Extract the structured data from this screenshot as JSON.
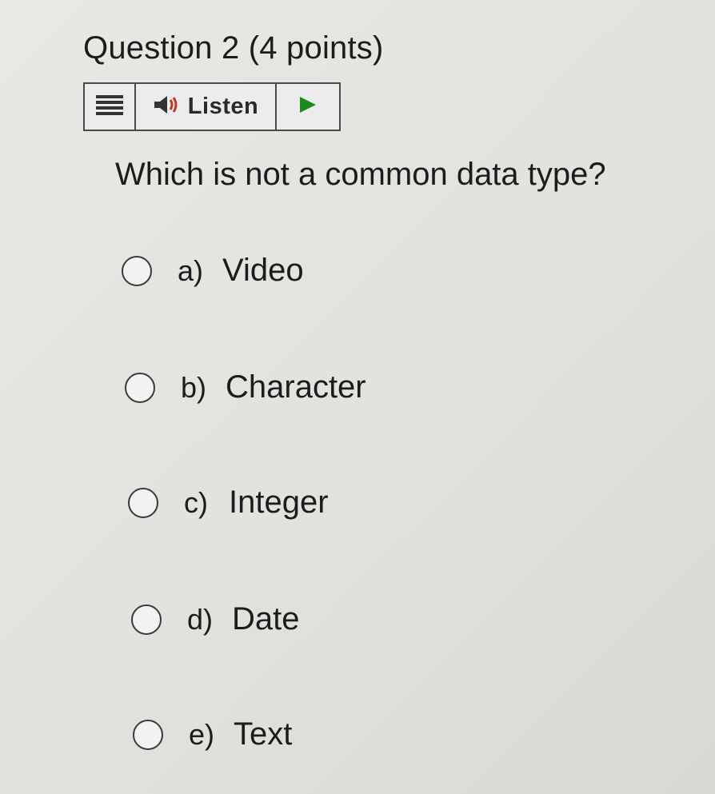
{
  "question": {
    "title": "Question 2 (4 points)",
    "prompt": "Which is not a common data type?"
  },
  "readspeaker": {
    "menu_icon": "hamburger-menu-icon",
    "speaker_icon": "speaker-icon",
    "listen_label": "Listen",
    "play_icon": "play-icon",
    "play_color": "#1e8a1e"
  },
  "options": [
    {
      "letter": "a)",
      "text": "Video"
    },
    {
      "letter": "b)",
      "text": "Character"
    },
    {
      "letter": "c)",
      "text": "Integer"
    },
    {
      "letter": "d)",
      "text": "Date"
    },
    {
      "letter": "e)",
      "text": "Text"
    }
  ]
}
